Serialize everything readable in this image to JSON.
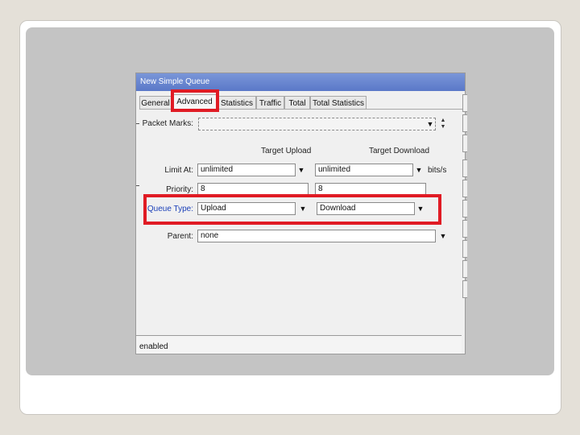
{
  "window": {
    "title": "New Simple Queue",
    "tabs": [
      "General",
      "Advanced",
      "Statistics",
      "Traffic",
      "Total",
      "Total Statistics"
    ],
    "active_tab": "Advanced"
  },
  "form": {
    "packet_marks": {
      "label": "Packet Marks:",
      "value": ""
    },
    "columns": {
      "upload": "Target Upload",
      "download": "Target Download"
    },
    "limit_at": {
      "label": "Limit At:",
      "upload": "unlimited",
      "download": "unlimited",
      "unit": "bits/s"
    },
    "priority": {
      "label": "Priority:",
      "upload": "8",
      "download": "8"
    },
    "queue_type": {
      "label": "Queue Type:",
      "upload": "Upload",
      "download": "Download"
    },
    "parent": {
      "label": "Parent:",
      "value": "none"
    }
  },
  "status": {
    "text": "enabled"
  },
  "icons": {
    "dropdown": "dropdown-arrow-icon",
    "scroll": "scroll-arrows-icon"
  },
  "colors": {
    "highlight": "#e01b24",
    "title_bar": "#5a78c8",
    "queue_label": "#1a3fb8"
  }
}
